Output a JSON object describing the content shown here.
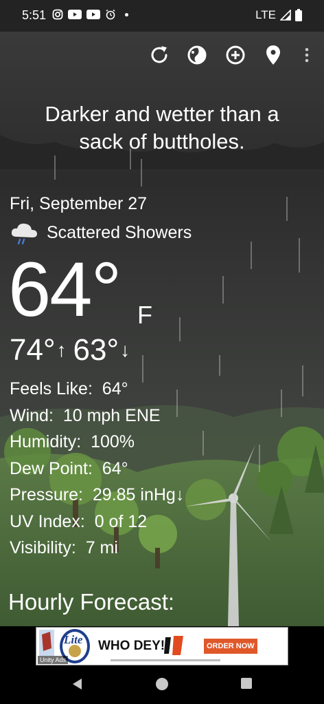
{
  "status_bar": {
    "time": "5:51",
    "network": "LTE"
  },
  "headline": "Darker and wetter than a sack of buttholes.",
  "weather": {
    "date": "Fri, September 27",
    "condition": "Scattered Showers",
    "temperature": "64°",
    "unit": "F",
    "high": "74°",
    "low": "63°"
  },
  "details": [
    {
      "label": "Feels Like:",
      "value": "64°"
    },
    {
      "label": "Wind:",
      "value": "10 mph ENE"
    },
    {
      "label": "Humidity:",
      "value": "100%"
    },
    {
      "label": "Dew Point:",
      "value": "64°"
    },
    {
      "label": "Pressure:",
      "value": "29.85 inHg↓"
    },
    {
      "label": "UV Index:",
      "value": "0 of 12"
    },
    {
      "label": "Visibility:",
      "value": "7 mi"
    }
  ],
  "hourly_title": "Hourly Forecast:",
  "ad": {
    "slogan": "WHO DEY!",
    "cta": "ORDER NOW",
    "brand": "Lite",
    "badge": "Unity Ads"
  },
  "icons": {
    "refresh": "refresh-icon",
    "theme": "theme-icon",
    "add": "add-location-icon",
    "location": "location-pin-icon",
    "overflow": "overflow-menu-icon"
  }
}
